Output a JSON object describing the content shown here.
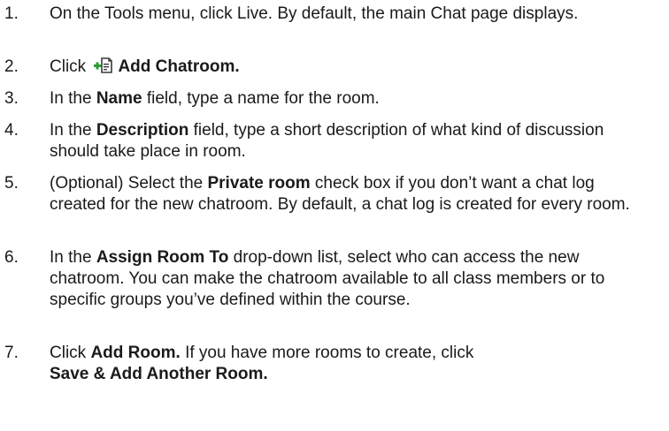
{
  "steps": [
    {
      "number": "1.",
      "text": "On the Tools menu, click Live. By default, the main Chat page displays."
    },
    {
      "number": "2.",
      "pre": "Click",
      "icon": "add-chatroom-icon",
      "bold": "Add Chatroom."
    },
    {
      "number": "3.",
      "pre": "In the",
      "bold": "Name",
      "post": "field, type a name for the room."
    },
    {
      "number": "4.",
      "pre": "In the",
      "bold": "Description",
      "post": "field, type a short description of what kind of discussion should take place in room."
    },
    {
      "number": "5.",
      "pre": "(Optional) Select the",
      "bold": "Private room",
      "post": "check box if you don’t want a chat log created for the new chatroom. By default, a chat log is created for every room."
    },
    {
      "number": "6.",
      "pre": "In the",
      "bold": "Assign Room To",
      "post": "drop-down list, select who can access the new chatroom. You can make the chatroom available to all class members or to specific groups you’ve defined within the course."
    },
    {
      "number": "7.",
      "pre": "Click",
      "bold": "Add Room.",
      "post": "If you have more rooms to create, click",
      "bold2": "Save & Add Another Room."
    }
  ],
  "colors": {
    "text": "#1a1a1a",
    "icon_plus": "#2e9b2e",
    "icon_page": "#3a3a3a"
  }
}
